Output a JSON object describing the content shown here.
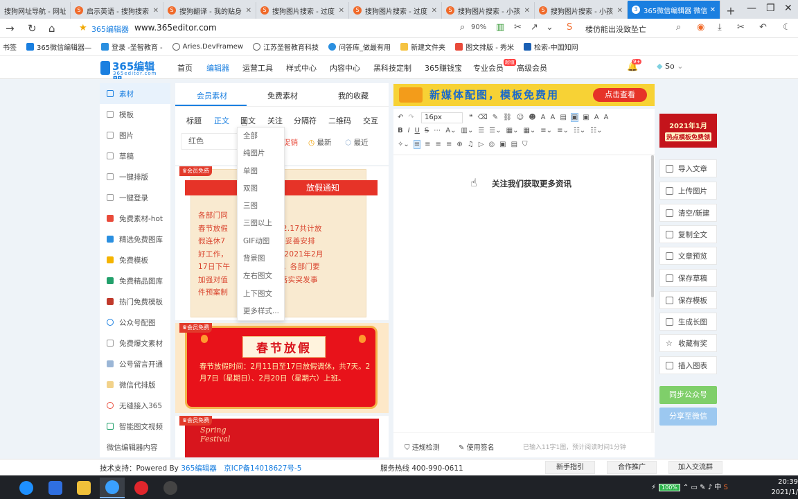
{
  "browser": {
    "tabs": [
      {
        "title": "搜狗网址导航 - 网址"
      },
      {
        "title": "启示英语 - 搜狗搜索"
      },
      {
        "title": "搜狗翻译 - 我的贴身"
      },
      {
        "title": "搜狗图片搜索 - 过度"
      },
      {
        "title": "搜狗图片搜索 - 过度"
      },
      {
        "title": "搜狗图片搜索 - 小孩"
      },
      {
        "title": "搜狗图片搜索 - 小孩"
      },
      {
        "title": "365微信编辑器 微信"
      }
    ],
    "new_tab": "+",
    "address": {
      "site_name": "365编辑器",
      "url": "www.365editor.com",
      "zoom": "90%",
      "search_hint": "楼仿能出没致坠亡"
    },
    "bookmarks": [
      {
        "label": "书签",
        "color": "#888888"
      },
      {
        "label": "365微信编辑器—",
        "color": "#1a7fe0"
      },
      {
        "label": "登录 -圣智教育 -",
        "color": "#2a8fe0"
      },
      {
        "label": "Aries.DevFramew",
        "color": "#666666"
      },
      {
        "label": "江苏圣智教育科技",
        "color": "#666666"
      },
      {
        "label": "问答库_做最有用",
        "color": "#2a8fe0"
      },
      {
        "label": "新建文件夹",
        "color": "#f5c342"
      },
      {
        "label": "图文排版 - 秀米",
        "color": "#e94a3a"
      },
      {
        "label": "检索-中国知网",
        "color": "#1a5fb4"
      }
    ]
  },
  "site": {
    "logo_text": "365编辑器",
    "logo_sub": "365editor.com",
    "nav": [
      "首页",
      "编辑器",
      "运营工具",
      "样式中心",
      "内容中心",
      "黑科技定制",
      "365赚钱宝",
      "专业会员",
      "高级会员"
    ],
    "nav_active": "编辑器",
    "hot_badge": "超值",
    "bell_badge": "9+",
    "user": "So"
  },
  "sidebar": {
    "items": [
      {
        "label": "素材"
      },
      {
        "label": "模板"
      },
      {
        "label": "图片"
      },
      {
        "label": "草稿"
      },
      {
        "label": "一键排版"
      },
      {
        "label": "一键登录"
      },
      {
        "label": "免费素材-hot"
      },
      {
        "label": "精选免费图库"
      },
      {
        "label": "免费模板"
      },
      {
        "label": "免费精品图库"
      },
      {
        "label": "热门免费模板"
      },
      {
        "label": "公众号配图"
      },
      {
        "label": "免费爆文素材"
      },
      {
        "label": "公号留言开通"
      },
      {
        "label": "微信代排版"
      },
      {
        "label": "无缝接入365"
      },
      {
        "label": "智能图文视频"
      },
      {
        "label": "微信编辑器内容"
      }
    ]
  },
  "material": {
    "tabs": [
      "会员素材",
      "免费素材",
      "我的收藏"
    ],
    "filters": [
      "标题",
      "正文",
      "图文",
      "关注",
      "分隔符",
      "二维码",
      "交互"
    ],
    "color_filter": "红色",
    "promo_text": "促销",
    "sort": [
      "最新",
      "最近"
    ],
    "vip_badge": "会员免费",
    "card1": {
      "title": "放假通知",
      "lines": [
        "各部门同",
        "春节放假",
        "2.11至2.17共计放",
        "假连休7",
        "接通知后，妥善安排",
        "好工作，",
        "上班时间于2021年2月",
        "17日下午",
        "到办公室。各部门要",
        "加强对值",
        "理，认真落实突发事",
        "件预案制"
      ]
    },
    "card2": {
      "title": "春节放假",
      "body": "春节放假时间：2月11日至17日放假调休，共7天。2月7日（星期日）、2月20日（星期六）上班。"
    },
    "card3": {
      "title_lines": [
        "Spring",
        "Festival"
      ]
    }
  },
  "dropdown": {
    "options": [
      "全部",
      "纯图片",
      "单图",
      "双图",
      "三图",
      "三图以上",
      "GIF动图",
      "背景图",
      "左右图文",
      "上下图文",
      "更多样式..."
    ]
  },
  "editor": {
    "banner_text": "新媒体配图，模板免费用",
    "banner_button": "点击查看",
    "font_size": "16px",
    "content": "关注我们获取更多资讯",
    "footer_check": "违规检测",
    "footer_sign": "使用签名",
    "word_count": "已输入11字1图，预计阅读时间1分钟"
  },
  "right_panel": {
    "promo_line1": "2021年1月",
    "promo_line2": "热点模板免费领",
    "buttons": [
      "导入文章",
      "上传图片",
      "清空/新建",
      "复制全文",
      "文章预览",
      "保存草稿",
      "保存模板",
      "生成长图",
      "收藏有奖",
      "插入图表"
    ],
    "sync_button": "同步公众号",
    "share_button": "分享至微信"
  },
  "footer": {
    "support_prefix": "技术支持：Powered By ",
    "support_link": "365编辑器",
    "icp": "京ICP备14018627号-5",
    "hotline": "服务热线 400-990-0611",
    "buttons": [
      "新手指引",
      "合作推广",
      "加入交流群"
    ]
  },
  "taskbar": {
    "battery": "100%",
    "ime": "中",
    "time": "20:39",
    "date": "2021/1/"
  }
}
